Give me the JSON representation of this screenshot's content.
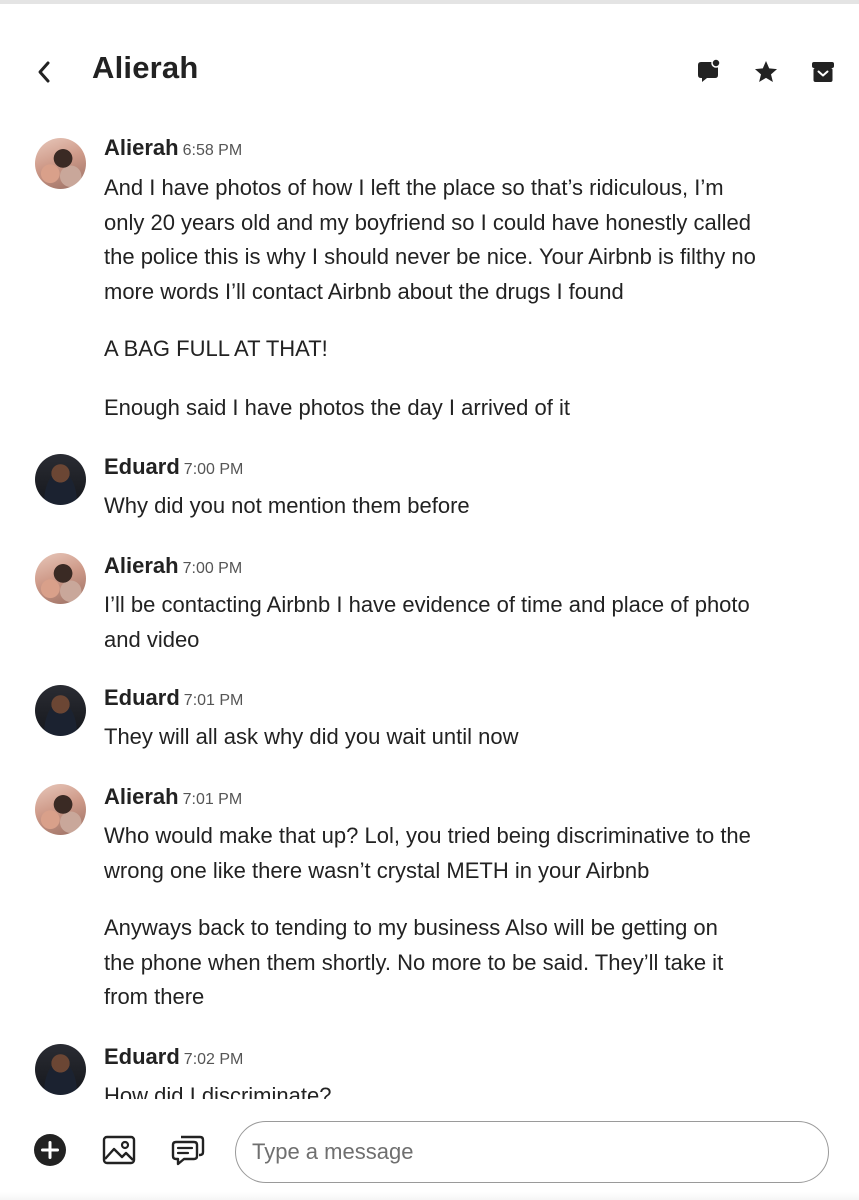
{
  "header": {
    "title": "Alierah",
    "icons": [
      "back-chevron",
      "chat-bubble",
      "star",
      "archive"
    ]
  },
  "messages": [
    {
      "sender": "Alierah",
      "time": "6:58 PM",
      "avatar": "alierah",
      "paragraphs": [
        [
          "And I have photos of how I left the place so that’s ridiculous, I’m",
          "only 20 years old and my boyfriend so I could have honestly called",
          "the police this is why I should never be nice. Your Airbnb is filthy no",
          "more words I’ll contact Airbnb about the drugs I found"
        ],
        [
          "A BAG FULL AT THAT!"
        ],
        [
          "Enough said I have photos the day I arrived of it"
        ]
      ]
    },
    {
      "sender": "Eduard",
      "time": "7:00 PM",
      "avatar": "eduard",
      "paragraphs": [
        [
          "Why did you not mention them before"
        ]
      ]
    },
    {
      "sender": "Alierah",
      "time": "7:00 PM",
      "avatar": "alierah",
      "paragraphs": [
        [
          "I’ll be contacting Airbnb I have evidence of time and place of photo",
          "and video"
        ]
      ]
    },
    {
      "sender": "Eduard",
      "time": "7:01 PM",
      "avatar": "eduard",
      "paragraphs": [
        [
          "They will all ask why did you wait until now"
        ]
      ]
    },
    {
      "sender": "Alierah",
      "time": "7:01 PM",
      "avatar": "alierah",
      "paragraphs": [
        [
          "Who would make that up? Lol, you tried being discriminative to the",
          "wrong one like there wasn’t crystal METH in your Airbnb"
        ],
        [
          "Anyways back to tending to my business Also will be getting on",
          "the phone when them shortly. No more to be said. They’ll take it",
          "from there"
        ]
      ]
    },
    {
      "sender": "Eduard",
      "time": "7:02 PM",
      "avatar": "eduard",
      "paragraphs": [
        [
          "How did I discriminate?"
        ]
      ]
    }
  ],
  "composer": {
    "placeholder": "Type a message",
    "icons": [
      "add-circle",
      "image",
      "quick-replies"
    ]
  }
}
